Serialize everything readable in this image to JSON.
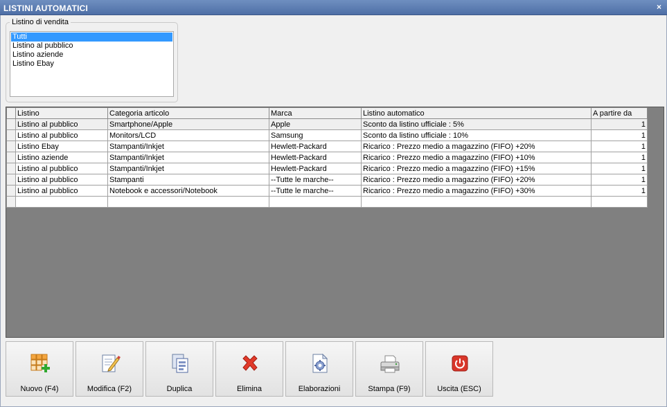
{
  "window": {
    "title": "LISTINI AUTOMATICI",
    "close_glyph": "×"
  },
  "filter": {
    "legend": "Listino di vendita",
    "items": [
      "Tutti",
      "Listino al pubblico",
      "Listino aziende",
      "Listino Ebay"
    ],
    "selected": "Tutti"
  },
  "grid": {
    "columns": [
      "Listino",
      "Categoria articolo",
      "Marca",
      "Listino automatico",
      "A partire da"
    ],
    "rows": [
      [
        "Listino al pubblico",
        "Smartphone/Apple",
        "Apple",
        "Sconto da listino ufficiale : 5%",
        "1"
      ],
      [
        "Listino al pubblico",
        "Monitors/LCD",
        "Samsung",
        "Sconto da listino ufficiale : 10%",
        "1"
      ],
      [
        "Listino Ebay",
        "Stampanti/Inkjet",
        "Hewlett-Packard",
        "Ricarico : Prezzo medio a magazzino (FIFO) +20%",
        "1"
      ],
      [
        "Listino aziende",
        "Stampanti/Inkjet",
        "Hewlett-Packard",
        "Ricarico : Prezzo medio a magazzino (FIFO) +10%",
        "1"
      ],
      [
        "Listino al pubblico",
        "Stampanti/Inkjet",
        "Hewlett-Packard",
        "Ricarico : Prezzo medio a magazzino (FIFO) +15%",
        "1"
      ],
      [
        "Listino al pubblico",
        "Stampanti",
        "--Tutte le marche--",
        "Ricarico : Prezzo medio a magazzino (FIFO) +20%",
        "1"
      ],
      [
        "Listino al pubblico",
        "Notebook e accessori/Notebook",
        "--Tutte le marche--",
        "Ricarico : Prezzo medio a magazzino (FIFO) +30%",
        "1"
      ]
    ]
  },
  "toolbar": {
    "buttons": [
      {
        "label": "Nuovo (F4)",
        "icon": "new-grid-icon"
      },
      {
        "label": "Modifica (F2)",
        "icon": "edit-document-icon"
      },
      {
        "label": "Duplica",
        "icon": "duplicate-icon"
      },
      {
        "label": "Elimina",
        "icon": "delete-x-icon"
      },
      {
        "label": "Elaborazioni",
        "icon": "process-gear-icon"
      },
      {
        "label": "Stampa (F9)",
        "icon": "printer-icon"
      },
      {
        "label": "Uscita (ESC)",
        "icon": "exit-power-icon"
      }
    ]
  }
}
